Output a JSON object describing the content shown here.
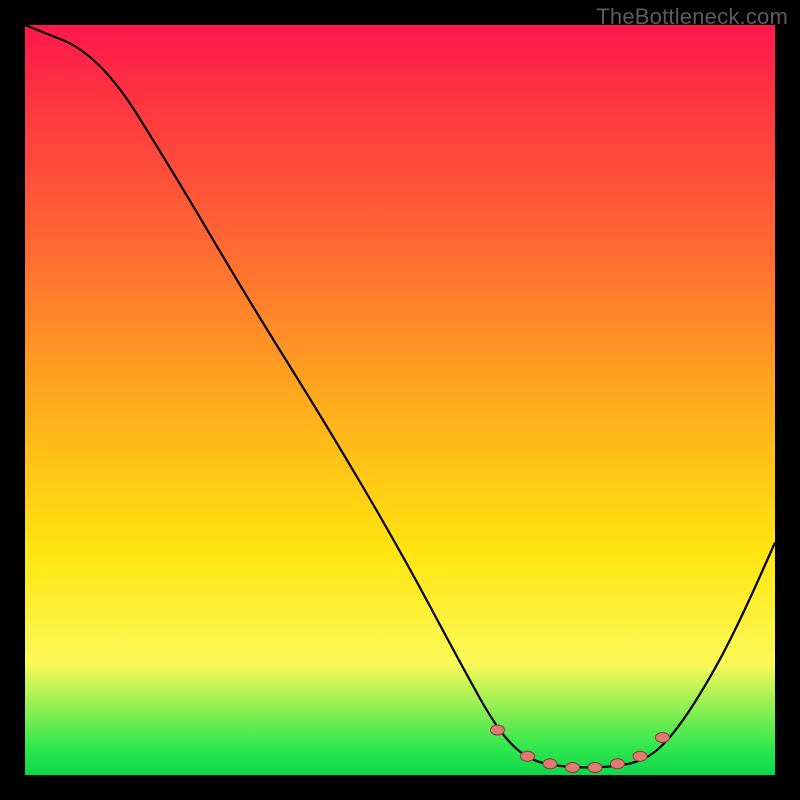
{
  "watermark": "TheBottleneck.com",
  "colors": {
    "background": "#000000",
    "curve_stroke": "#000000",
    "marker_fill": "#e07a74",
    "marker_stroke": "#8b3a3a",
    "gradient_top": "#ff184b",
    "gradient_bottom": "#0bd84a"
  },
  "chart_data": {
    "type": "line",
    "title": "",
    "xlabel": "",
    "ylabel": "",
    "xlim": [
      0,
      100
    ],
    "ylim": [
      0,
      100
    ],
    "note": "no axis ticks or labels rendered; values estimated from pixel positions mapped onto a 0–100 × 0–100 grid, y=0 at bottom",
    "curve": [
      {
        "x": 0,
        "y": 100
      },
      {
        "x": 10,
        "y": 96
      },
      {
        "x": 20,
        "y": 80
      },
      {
        "x": 30,
        "y": 63
      },
      {
        "x": 40,
        "y": 47
      },
      {
        "x": 50,
        "y": 30
      },
      {
        "x": 58,
        "y": 15
      },
      {
        "x": 63,
        "y": 6
      },
      {
        "x": 67,
        "y": 2
      },
      {
        "x": 72,
        "y": 1
      },
      {
        "x": 78,
        "y": 1
      },
      {
        "x": 83,
        "y": 2
      },
      {
        "x": 87,
        "y": 6
      },
      {
        "x": 92,
        "y": 14
      },
      {
        "x": 96,
        "y": 22
      },
      {
        "x": 100,
        "y": 31
      }
    ],
    "markers": [
      {
        "x": 63,
        "y": 6
      },
      {
        "x": 67,
        "y": 2.5
      },
      {
        "x": 70,
        "y": 1.5
      },
      {
        "x": 73,
        "y": 1
      },
      {
        "x": 76,
        "y": 1
      },
      {
        "x": 79,
        "y": 1.5
      },
      {
        "x": 82,
        "y": 2.5
      },
      {
        "x": 85,
        "y": 5
      }
    ]
  }
}
